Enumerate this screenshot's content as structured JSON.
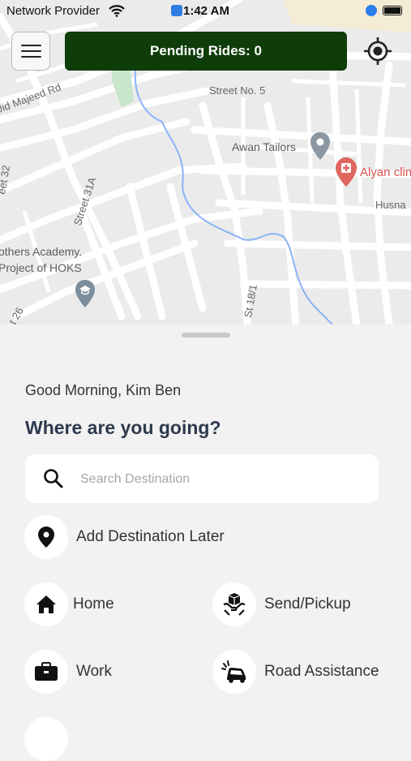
{
  "status_bar": {
    "carrier": "Network Provider",
    "time": "1:42 AM"
  },
  "map": {
    "labels": {
      "street_no_5": "Street No. 5",
      "majeed_rd": "Jid Majeed Rd",
      "awan_tailors": "Awan Tailors",
      "alyan_clinic": "Alyan clin",
      "husna": "Husna",
      "street_31a": "Street 31A",
      "street_32": "eet 32",
      "academy_line1": "others Academy.",
      "academy_line2": "Project of HOKS",
      "st_18": "St 18/1",
      "t_26": "t 26"
    }
  },
  "header": {
    "pending_rides": "Pending Rides: 0",
    "menu_icon": "hamburger-menu-icon",
    "locate_icon": "current-location-icon",
    "brand_color": "#0e3d0a"
  },
  "sheet": {
    "greeting": "Good Morning, Kim Ben",
    "question": "Where are you going?",
    "search": {
      "placeholder": "Search Destination",
      "value": ""
    },
    "add_later": "Add Destination Later",
    "shortcuts": {
      "home": "Home",
      "send_pickup": "Send/Pickup",
      "work": "Work",
      "road_assistance": "Road Assistance"
    }
  }
}
